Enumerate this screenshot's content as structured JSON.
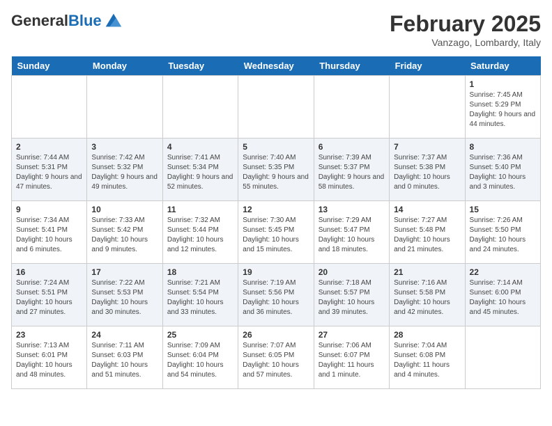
{
  "header": {
    "logo_general": "General",
    "logo_blue": "Blue",
    "month_title": "February 2025",
    "subtitle": "Vanzago, Lombardy, Italy"
  },
  "days_of_week": [
    "Sunday",
    "Monday",
    "Tuesday",
    "Wednesday",
    "Thursday",
    "Friday",
    "Saturday"
  ],
  "weeks": [
    [
      {
        "num": "",
        "info": ""
      },
      {
        "num": "",
        "info": ""
      },
      {
        "num": "",
        "info": ""
      },
      {
        "num": "",
        "info": ""
      },
      {
        "num": "",
        "info": ""
      },
      {
        "num": "",
        "info": ""
      },
      {
        "num": "1",
        "info": "Sunrise: 7:45 AM\nSunset: 5:29 PM\nDaylight: 9 hours and 44 minutes."
      }
    ],
    [
      {
        "num": "2",
        "info": "Sunrise: 7:44 AM\nSunset: 5:31 PM\nDaylight: 9 hours and 47 minutes."
      },
      {
        "num": "3",
        "info": "Sunrise: 7:42 AM\nSunset: 5:32 PM\nDaylight: 9 hours and 49 minutes."
      },
      {
        "num": "4",
        "info": "Sunrise: 7:41 AM\nSunset: 5:34 PM\nDaylight: 9 hours and 52 minutes."
      },
      {
        "num": "5",
        "info": "Sunrise: 7:40 AM\nSunset: 5:35 PM\nDaylight: 9 hours and 55 minutes."
      },
      {
        "num": "6",
        "info": "Sunrise: 7:39 AM\nSunset: 5:37 PM\nDaylight: 9 hours and 58 minutes."
      },
      {
        "num": "7",
        "info": "Sunrise: 7:37 AM\nSunset: 5:38 PM\nDaylight: 10 hours and 0 minutes."
      },
      {
        "num": "8",
        "info": "Sunrise: 7:36 AM\nSunset: 5:40 PM\nDaylight: 10 hours and 3 minutes."
      }
    ],
    [
      {
        "num": "9",
        "info": "Sunrise: 7:34 AM\nSunset: 5:41 PM\nDaylight: 10 hours and 6 minutes."
      },
      {
        "num": "10",
        "info": "Sunrise: 7:33 AM\nSunset: 5:42 PM\nDaylight: 10 hours and 9 minutes."
      },
      {
        "num": "11",
        "info": "Sunrise: 7:32 AM\nSunset: 5:44 PM\nDaylight: 10 hours and 12 minutes."
      },
      {
        "num": "12",
        "info": "Sunrise: 7:30 AM\nSunset: 5:45 PM\nDaylight: 10 hours and 15 minutes."
      },
      {
        "num": "13",
        "info": "Sunrise: 7:29 AM\nSunset: 5:47 PM\nDaylight: 10 hours and 18 minutes."
      },
      {
        "num": "14",
        "info": "Sunrise: 7:27 AM\nSunset: 5:48 PM\nDaylight: 10 hours and 21 minutes."
      },
      {
        "num": "15",
        "info": "Sunrise: 7:26 AM\nSunset: 5:50 PM\nDaylight: 10 hours and 24 minutes."
      }
    ],
    [
      {
        "num": "16",
        "info": "Sunrise: 7:24 AM\nSunset: 5:51 PM\nDaylight: 10 hours and 27 minutes."
      },
      {
        "num": "17",
        "info": "Sunrise: 7:22 AM\nSunset: 5:53 PM\nDaylight: 10 hours and 30 minutes."
      },
      {
        "num": "18",
        "info": "Sunrise: 7:21 AM\nSunset: 5:54 PM\nDaylight: 10 hours and 33 minutes."
      },
      {
        "num": "19",
        "info": "Sunrise: 7:19 AM\nSunset: 5:56 PM\nDaylight: 10 hours and 36 minutes."
      },
      {
        "num": "20",
        "info": "Sunrise: 7:18 AM\nSunset: 5:57 PM\nDaylight: 10 hours and 39 minutes."
      },
      {
        "num": "21",
        "info": "Sunrise: 7:16 AM\nSunset: 5:58 PM\nDaylight: 10 hours and 42 minutes."
      },
      {
        "num": "22",
        "info": "Sunrise: 7:14 AM\nSunset: 6:00 PM\nDaylight: 10 hours and 45 minutes."
      }
    ],
    [
      {
        "num": "23",
        "info": "Sunrise: 7:13 AM\nSunset: 6:01 PM\nDaylight: 10 hours and 48 minutes."
      },
      {
        "num": "24",
        "info": "Sunrise: 7:11 AM\nSunset: 6:03 PM\nDaylight: 10 hours and 51 minutes."
      },
      {
        "num": "25",
        "info": "Sunrise: 7:09 AM\nSunset: 6:04 PM\nDaylight: 10 hours and 54 minutes."
      },
      {
        "num": "26",
        "info": "Sunrise: 7:07 AM\nSunset: 6:05 PM\nDaylight: 10 hours and 57 minutes."
      },
      {
        "num": "27",
        "info": "Sunrise: 7:06 AM\nSunset: 6:07 PM\nDaylight: 11 hours and 1 minute."
      },
      {
        "num": "28",
        "info": "Sunrise: 7:04 AM\nSunset: 6:08 PM\nDaylight: 11 hours and 4 minutes."
      },
      {
        "num": "",
        "info": ""
      }
    ]
  ]
}
